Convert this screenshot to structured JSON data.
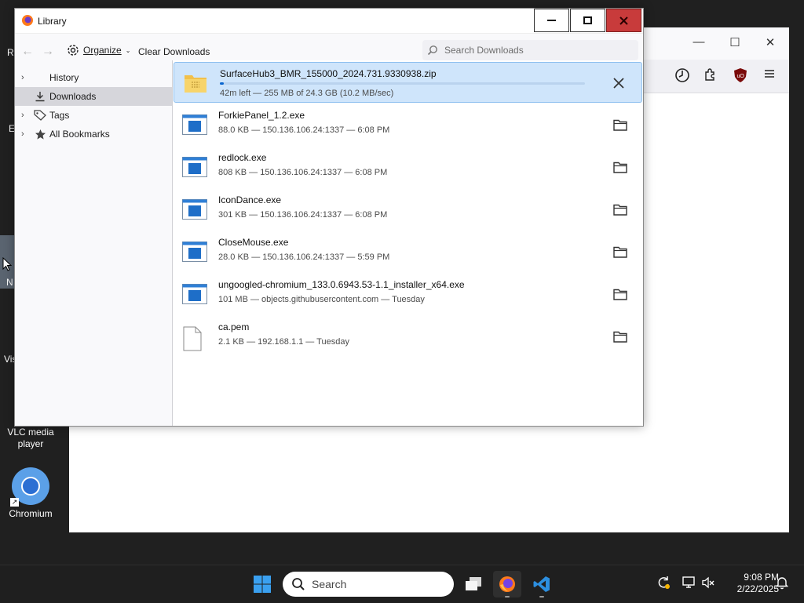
{
  "desktop": {
    "fragments": [
      "R",
      "E",
      "N",
      "Vis"
    ],
    "icons": [
      {
        "label": "VLC media player"
      },
      {
        "label": "Chromium"
      }
    ]
  },
  "library": {
    "title": "Library",
    "toolbar": {
      "organize_label": "Organize",
      "clear_label": "Clear Downloads",
      "search_placeholder": "Search Downloads"
    },
    "sidebar": [
      {
        "label": "History",
        "icon": "history-icon",
        "expandable": true
      },
      {
        "label": "Downloads",
        "icon": "download-icon",
        "expandable": false,
        "selected": true
      },
      {
        "label": "Tags",
        "icon": "tag-icon",
        "expandable": true
      },
      {
        "label": "All Bookmarks",
        "icon": "star-icon",
        "expandable": true
      }
    ],
    "downloads": [
      {
        "name": "SurfaceHub3_BMR_155000_2024.731.9330938.zip",
        "status": "42m left — 255 MB of 24.3 GB (10.2 MB/sec)",
        "type": "zip",
        "in_progress": true,
        "progress": 0.0105
      },
      {
        "name": "ForkiePanel_1.2.exe",
        "status": "88.0 KB — 150.136.106.24:1337 — 6:08 PM",
        "type": "exe"
      },
      {
        "name": "redlock.exe",
        "status": "808 KB — 150.136.106.24:1337 — 6:08 PM",
        "type": "exe"
      },
      {
        "name": "IconDance.exe",
        "status": "301 KB — 150.136.106.24:1337 — 6:08 PM",
        "type": "exe"
      },
      {
        "name": "CloseMouse.exe",
        "status": "28.0 KB — 150.136.106.24:1337 — 5:59 PM",
        "type": "exe"
      },
      {
        "name": "ungoogled-chromium_133.0.6943.53-1.1_installer_x64.exe",
        "status": "101 MB — objects.githubusercontent.com — Tuesday",
        "type": "exe"
      },
      {
        "name": "ca.pem",
        "status": "2.1 KB — 192.168.1.1 — Tuesday",
        "type": "file"
      }
    ]
  },
  "taskbar": {
    "search_label": "Search",
    "time": "9:08 PM",
    "date": "2/22/2025"
  },
  "colors": {
    "accent": "#0a66d0",
    "active_row": "#cfe5fb",
    "close_button": "#c83b3b",
    "taskbar": "#1f1f1f"
  }
}
